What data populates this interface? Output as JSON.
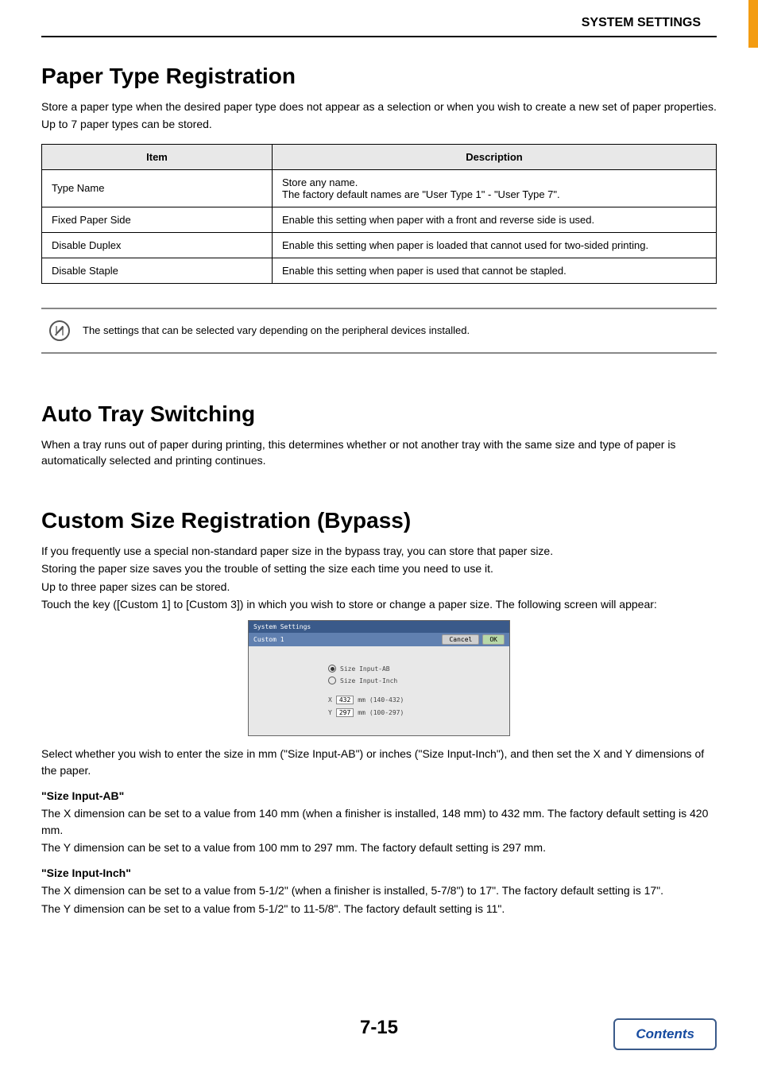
{
  "header": {
    "title": "SYSTEM SETTINGS"
  },
  "section1": {
    "heading": "Paper Type Registration",
    "p1": "Store a paper type when the desired paper type does not appear as a selection or when you wish to create a new set of paper properties.",
    "p2": "Up to 7 paper types can be stored.",
    "table": {
      "head_item": "Item",
      "head_desc": "Description",
      "rows": [
        {
          "item": "Type Name",
          "desc": "Store any name.\nThe factory default names are \"User Type 1\" - \"User Type 7\"."
        },
        {
          "item": "Fixed Paper Side",
          "desc": "Enable this setting when paper with a front and reverse side is used."
        },
        {
          "item": "Disable Duplex",
          "desc": "Enable this setting when paper is loaded that cannot used for two-sided printing."
        },
        {
          "item": "Disable Staple",
          "desc": "Enable this setting when paper is used that cannot be stapled."
        }
      ]
    },
    "note": "The settings that can be selected vary depending on the peripheral devices installed."
  },
  "section2": {
    "heading": "Auto Tray Switching",
    "p1": "When a tray runs out of paper during printing, this determines whether or not another tray with the same size and type of paper is automatically selected and printing continues."
  },
  "section3": {
    "heading": "Custom Size Registration (Bypass)",
    "p1": "If you frequently use a special non-standard paper size in the bypass tray, you can store that paper size.",
    "p2": "Storing the paper size saves you the trouble of setting the size each time you need to use it.",
    "p3": "Up to three paper sizes can be stored.",
    "p4": "Touch the key ([Custom 1] to [Custom 3]) in which you wish to store or change a paper size. The following screen will appear:",
    "screen": {
      "title_bar": "System Settings",
      "subtitle": "Custom 1",
      "cancel": "Cancel",
      "ok": "OK",
      "radio_ab": "Size Input-AB",
      "radio_inch": "Size Input-Inch",
      "x_label": "X",
      "x_value": "432",
      "x_unit": "mm",
      "x_range": "(140-432)",
      "y_label": "Y",
      "y_value": "297",
      "y_unit": "mm",
      "y_range": "(100-297)"
    },
    "p5": "Select whether you wish to enter the size in mm (\"Size Input-AB\") or inches (\"Size Input-Inch\"), and then set the X and Y dimensions of the paper.",
    "sub_ab": "\"Size Input-AB\"",
    "ab_x": "The X dimension can be set to a value from 140 mm (when a finisher is installed, 148 mm) to 432 mm. The factory default setting is 420 mm.",
    "ab_y": "The Y dimension can be set to a value from 100 mm to 297 mm. The factory default setting is 297 mm.",
    "sub_inch": "\"Size Input-Inch\"",
    "inch_x": "The X dimension can be set to a value from 5-1/2\" (when a finisher is installed, 5-7/8\") to 17\". The factory default setting is 17\".",
    "inch_y": "The Y dimension can be set to a value from 5-1/2\" to 11-5/8\". The factory default setting is 11\"."
  },
  "footer": {
    "page": "7-15",
    "contents": "Contents"
  }
}
